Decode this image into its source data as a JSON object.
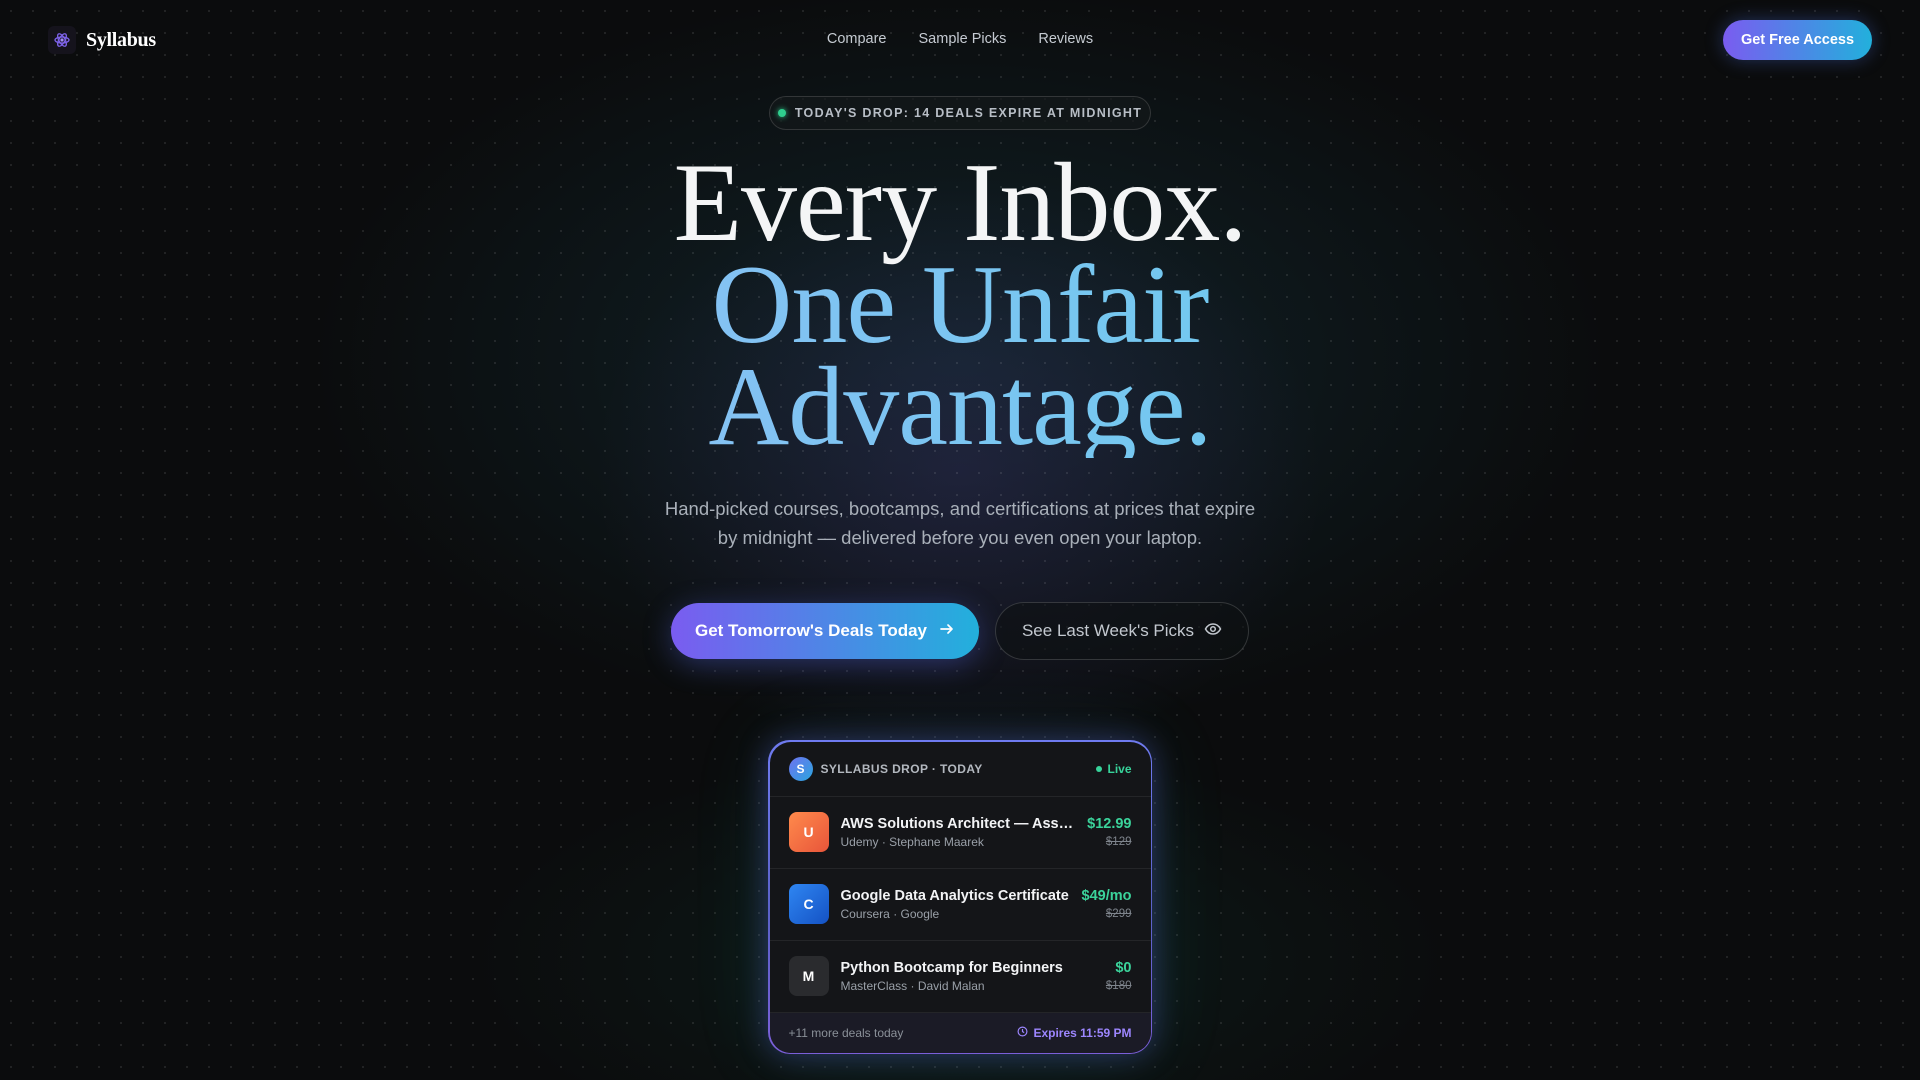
{
  "nav": {
    "brand": "Syllabus",
    "links": [
      "Compare",
      "Sample Picks",
      "Reviews"
    ],
    "cta": "Get Free Access"
  },
  "hero": {
    "pill": "TODAY'S DROP: 14 DEALS EXPIRE AT MIDNIGHT",
    "headline": [
      "Every Inbox.",
      "One Unfair",
      "Advantage."
    ],
    "subtitle": "Hand-picked courses, bootcamps, and certifications at prices that expire by midnight — delivered before you even open your laptop.",
    "primary_cta": "Get Tomorrow's Deals Today",
    "secondary_cta": "See Last Week's Picks"
  },
  "card": {
    "badge": "S",
    "title": "SYLLABUS DROP · TODAY",
    "status": "Live",
    "deals": [
      {
        "initial": "U",
        "title": "AWS Solutions Architect — Associate",
        "meta": "Udemy · Stephane Maarek",
        "price": "$12.99",
        "was": "$129",
        "color": "#f26b3a"
      },
      {
        "initial": "C",
        "title": "Google Data Analytics Certificate",
        "meta": "Coursera · Google",
        "price": "$49/mo",
        "was": "$299",
        "color": "#1f6fe0"
      },
      {
        "initial": "M",
        "title": "Python Bootcamp for Beginners",
        "meta": "MasterClass · David Malan",
        "price": "$0",
        "was": "$180",
        "color": "#2a2b2e"
      }
    ],
    "more": "+11 more deals today",
    "expires": "Expires 11:59 PM"
  },
  "colors": {
    "accent_start": "#7a5cf0",
    "accent_end": "#22b0dc",
    "live_green": "#37d39a",
    "expires_purple": "#9d86ff"
  },
  "icons": [
    "syllabus-logo-icon",
    "arrow-right-icon",
    "eye-icon",
    "clock-icon"
  ]
}
